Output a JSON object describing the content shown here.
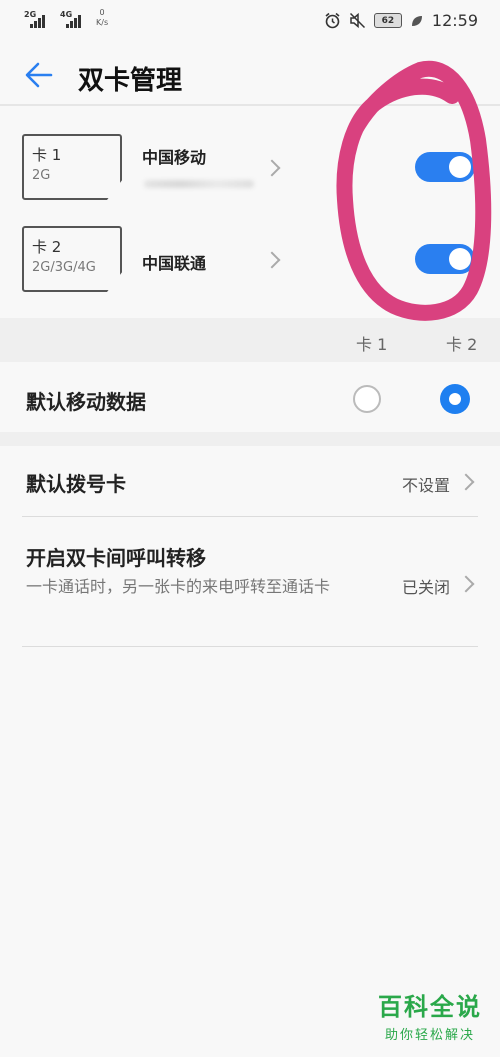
{
  "status_bar": {
    "sim1_network": "2G",
    "sim2_network": "4G",
    "net_speed_value": "0",
    "net_speed_unit": "K/s",
    "battery": "62",
    "time": "12:59"
  },
  "header": {
    "title": "双卡管理"
  },
  "sims": [
    {
      "name": "卡 1",
      "network": "2G",
      "carrier": "中国移动",
      "enabled": true
    },
    {
      "name": "卡 2",
      "network": "2G/3G/4G",
      "carrier": "中国联通",
      "enabled": true
    }
  ],
  "columns": {
    "card1": "卡 1",
    "card2": "卡 2"
  },
  "settings": {
    "default_data": {
      "label": "默认移动数据",
      "selected": "卡 2"
    },
    "default_dial": {
      "label": "默认拨号卡",
      "value": "不设置"
    },
    "call_forward": {
      "label": "开启双卡间呼叫转移",
      "description": "一卡通话时，另一张卡的来电呼转至通话卡",
      "value": "已关闭"
    }
  },
  "colors": {
    "accent": "#2a7ff0",
    "annotation": "#d9417f",
    "watermark": "#2aa84a"
  },
  "watermark": {
    "main": "百科全说",
    "sub": "助你轻松解决"
  }
}
